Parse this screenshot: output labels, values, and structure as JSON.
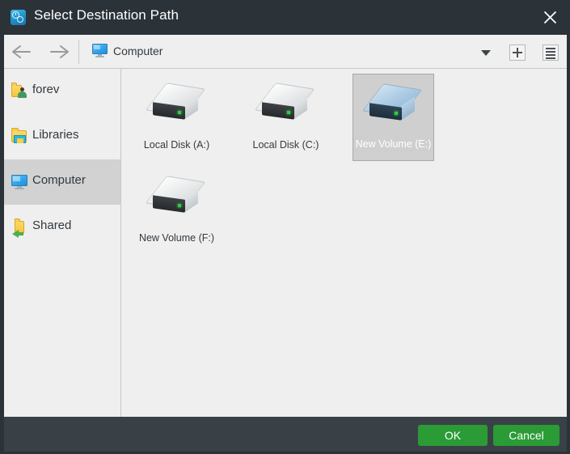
{
  "window": {
    "title": "Select Destination Path",
    "app_icon": "gears-icon",
    "close_icon": "close-icon",
    "accent_green": "#2b9b36",
    "titlebar_color": "#2b3238",
    "footer_color": "#3a4146"
  },
  "navbar": {
    "back_icon": "arrow-left-icon",
    "forward_icon": "arrow-right-icon",
    "location_icon": "computer-icon",
    "location": "Computer",
    "dropdown_icon": "chevron-down-icon",
    "new_folder_icon": "plus-box-icon",
    "view_mode_icon": "list-view-icon"
  },
  "sidebar": {
    "items": [
      {
        "label": "forev",
        "icon": "user-folder-icon",
        "selected": false
      },
      {
        "label": "Libraries",
        "icon": "libraries-icon",
        "selected": false
      },
      {
        "label": "Computer",
        "icon": "computer-icon",
        "selected": true
      },
      {
        "label": "Shared",
        "icon": "shared-folder-icon",
        "selected": false
      }
    ]
  },
  "content": {
    "items": [
      {
        "label": "Local Disk (A:)",
        "icon": "hard-disk-icon",
        "selected": false
      },
      {
        "label": "Local Disk (C:)",
        "icon": "hard-disk-icon",
        "selected": false
      },
      {
        "label": "New Volume (E:)",
        "icon": "hard-disk-icon",
        "selected": true
      },
      {
        "label": "New Volume (F:)",
        "icon": "hard-disk-icon",
        "selected": false
      }
    ]
  },
  "footer": {
    "ok_label": "OK",
    "cancel_label": "Cancel"
  }
}
